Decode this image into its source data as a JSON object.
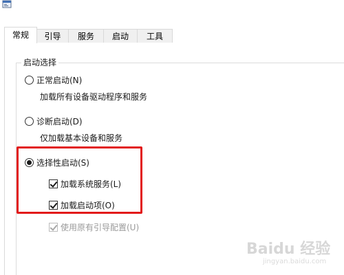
{
  "tabs": [
    {
      "label": "常规",
      "active": true
    },
    {
      "label": "引导",
      "active": false
    },
    {
      "label": "服务",
      "active": false
    },
    {
      "label": "启动",
      "active": false
    },
    {
      "label": "工具",
      "active": false
    }
  ],
  "startup_group": {
    "title": "启动选择",
    "normal": {
      "label": "正常启动(N)",
      "description": "加载所有设备驱动程序和服务",
      "selected": false
    },
    "diagnostic": {
      "label": "诊断启动(D)",
      "description": "仅加载基本设备和服务",
      "selected": false
    },
    "selective": {
      "label": "选择性启动(S)",
      "selected": true,
      "load_system_services": {
        "label": "加载系统服务(L)",
        "checked": true,
        "enabled": true
      },
      "load_startup_items": {
        "label": "加载启动项(O)",
        "checked": true,
        "enabled": true
      },
      "use_original_boot_config": {
        "label": "使用原有引导配置(U)",
        "checked": true,
        "enabled": false
      }
    }
  },
  "annotation": {
    "color": "#e21a1a"
  },
  "watermark": {
    "text": "Baidu 经验",
    "subtext": "jingyan.baidu.com"
  },
  "icons": {
    "app": "msconfig-window-icon"
  }
}
